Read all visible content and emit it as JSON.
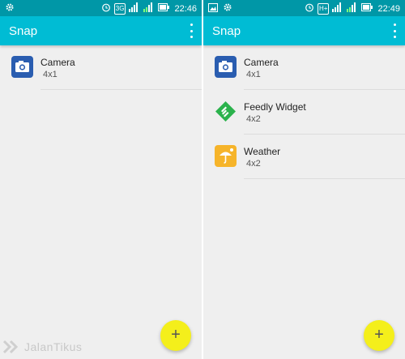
{
  "screens": [
    {
      "status": {
        "time": "22:46",
        "network": "3G"
      },
      "app_title": "Snap",
      "items": [
        {
          "name": "Camera",
          "size": "4x1",
          "icon": "camera-icon"
        }
      ],
      "fab_label": "+"
    },
    {
      "status": {
        "time": "22:49",
        "network": "H+"
      },
      "app_title": "Snap",
      "items": [
        {
          "name": "Camera",
          "size": "4x1",
          "icon": "camera-icon"
        },
        {
          "name": "Feedly Widget",
          "size": "4x2",
          "icon": "feedly-icon"
        },
        {
          "name": "Weather",
          "size": "4x2",
          "icon": "weather-icon"
        }
      ],
      "fab_label": "+"
    }
  ],
  "watermark": "JalanTikus",
  "colors": {
    "status_bar": "#0097a7",
    "app_bar": "#00bcd4",
    "fab": "#f4ef1b",
    "background": "#efefef"
  }
}
